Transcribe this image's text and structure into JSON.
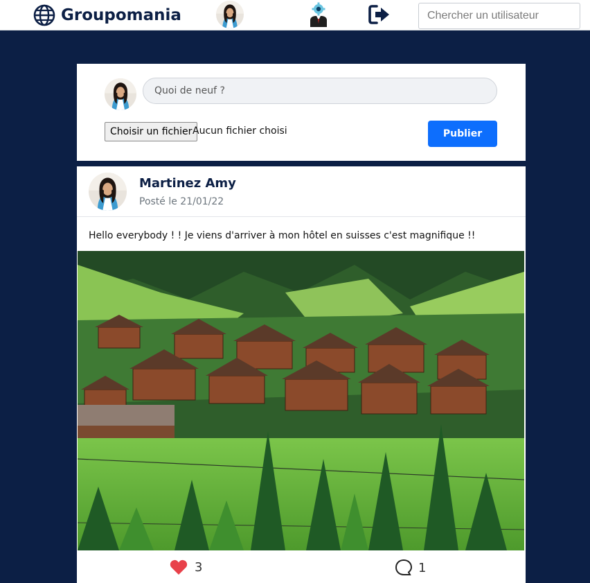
{
  "header": {
    "brand": "Groupomania",
    "search_placeholder": "Chercher un utilisateur",
    "icons": [
      "globe-icon",
      "user-avatar",
      "admin-icon",
      "logout-icon"
    ]
  },
  "compose": {
    "placeholder": "Quoi de neuf ?",
    "file_button": "Choisir un fichier",
    "file_status": "Aucun fichier choisi",
    "publish_label": "Publier"
  },
  "post": {
    "author": "Martinez Amy",
    "date": "Posté le 21/01/22",
    "text": "Hello everybody ! ! Je viens d'arriver à mon hôtel en suisses c'est magnifique !!",
    "likes": "3",
    "comments": "1"
  },
  "colors": {
    "navy": "#0c1f45",
    "primary": "#0d6efd",
    "like": "#e8414a"
  }
}
